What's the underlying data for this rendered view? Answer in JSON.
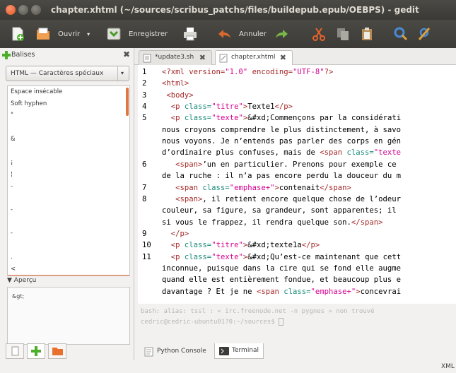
{
  "window": {
    "title": "chapter.xhtml (~/sources/scribus_patchs/files/buildepub.epub/OEBPS) - gedit"
  },
  "toolbar": {
    "open_label": "Ouvrir",
    "save_label": "Enregistrer",
    "undo_label": "Annuler"
  },
  "sidebar": {
    "title": "Balises",
    "combo_value": "HTML — Caractères spéciaux",
    "items": [
      "Espace insécable",
      "Soft hyphen",
      "\"",
      "",
      "&",
      "",
      "¡",
      "¦",
      "-",
      "",
      "-",
      "",
      "-",
      "",
      ".",
      "<",
      ">",
      "±",
      "«",
      ""
    ],
    "selected_index": 16,
    "preview_title": "Aperçu",
    "preview_text": "&gt;"
  },
  "tabs": [
    {
      "label": "*update3.sh"
    },
    {
      "label": "chapter.xhtml"
    }
  ],
  "editor": {
    "lines": [
      {
        "n": "1",
        "html": "<span class=\"t-pi\">&lt;?xml version=</span><span class=\"t-str\">\"1.0\"</span><span class=\"t-pi\"> encoding=</span><span class=\"t-str\">\"UTF-8\"</span><span class=\"t-pi\">?&gt;</span>"
      },
      {
        "n": "2",
        "html": "<span class=\"t-tag\">&lt;html&gt;</span>"
      },
      {
        "n": "3",
        "html": " <span class=\"t-tag\">&lt;body&gt;</span>"
      },
      {
        "n": "4",
        "html": "  <span class=\"t-tag\">&lt;p</span> <span class=\"t-att\">class=</span><span class=\"t-str\">\"titre\"</span><span class=\"t-tag\">&gt;</span>Texte1<span class=\"t-tag\">&lt;/p&gt;</span>"
      },
      {
        "n": "5",
        "html": "  <span class=\"t-tag\">&lt;p</span> <span class=\"t-att\">class=</span><span class=\"t-str\">\"texte\"</span><span class=\"t-tag\">&gt;</span>&amp;#xd;Commençons par la considérati"
      },
      {
        "n": "",
        "html": "nous croyons comprendre le plus distinctement, à savo"
      },
      {
        "n": "",
        "html": "nous voyons. Je n’entends pas parler des corps en gén"
      },
      {
        "n": "",
        "html": "d’ordinaire plus confuses, mais de <span class=\"t-tag\">&lt;span</span> <span class=\"t-att\">class=</span><span class=\"t-str\">\"texte</span>"
      },
      {
        "n": "6",
        "html": "   <span class=\"t-tag\">&lt;span&gt;</span>’un en particulier. Prenons pour exemple ce"
      },
      {
        "n": "",
        "html": "de la ruche : il n’a pas encore perdu la douceur du m"
      },
      {
        "n": "7",
        "html": "   <span class=\"t-tag\">&lt;span</span> <span class=\"t-att\">class=</span><span class=\"t-str\">\"emphase+\"</span><span class=\"t-tag\">&gt;</span>contenait<span class=\"t-tag\">&lt;/span&gt;</span>"
      },
      {
        "n": "8",
        "html": "   <span class=\"t-tag\">&lt;span&gt;</span>, il retient encore quelque chose de l’odeur"
      },
      {
        "n": "",
        "html": "couleur, sa figure, sa grandeur, sont apparentes; il"
      },
      {
        "n": "",
        "html": "si vous le frappez, il rendra quelque son.<span class=\"t-tag\">&lt;/span&gt;</span>"
      },
      {
        "n": "9",
        "html": "  <span class=\"t-tag\">&lt;/p&gt;</span>"
      },
      {
        "n": "10",
        "html": "  <span class=\"t-tag\">&lt;p</span> <span class=\"t-att\">class=</span><span class=\"t-str\">\"titre\"</span><span class=\"t-tag\">&gt;</span>&amp;#xd;texte1a<span class=\"t-tag\">&lt;/p&gt;</span>"
      },
      {
        "n": "11",
        "html": "  <span class=\"t-tag\">&lt;p</span> <span class=\"t-att\">class=</span><span class=\"t-str\">\"texte\"</span><span class=\"t-tag\">&gt;</span>&amp;#xd;Qu’est-ce maintenant que cett"
      },
      {
        "n": "",
        "html": "inconnue, puisque dans la cire qui se fond elle augme"
      },
      {
        "n": "",
        "html": "quand elle est entièrement fondue, et beaucoup plus e"
      },
      {
        "n": "",
        "html": "davantage ? Et je ne <span class=\"t-tag\">&lt;span</span> <span class=\"t-att\">class=</span><span class=\"t-str\">\"emphase+\"</span><span class=\"t-tag\">&gt;</span>concevrai"
      }
    ]
  },
  "terminal": {
    "line1": "bash: alias: tssl : « irc.freenode.net -n pygnes » non trouvé",
    "line2": "cedric@cedric-ubuntu01?0:~/sources$"
  },
  "bottom_tabs": [
    {
      "label": "Python Console"
    },
    {
      "label": "Terminal"
    }
  ],
  "status": {
    "language": "XML"
  },
  "colors": {
    "close": "#f15d22",
    "selection": "#f07746",
    "titlebar": "#3c3b37"
  }
}
